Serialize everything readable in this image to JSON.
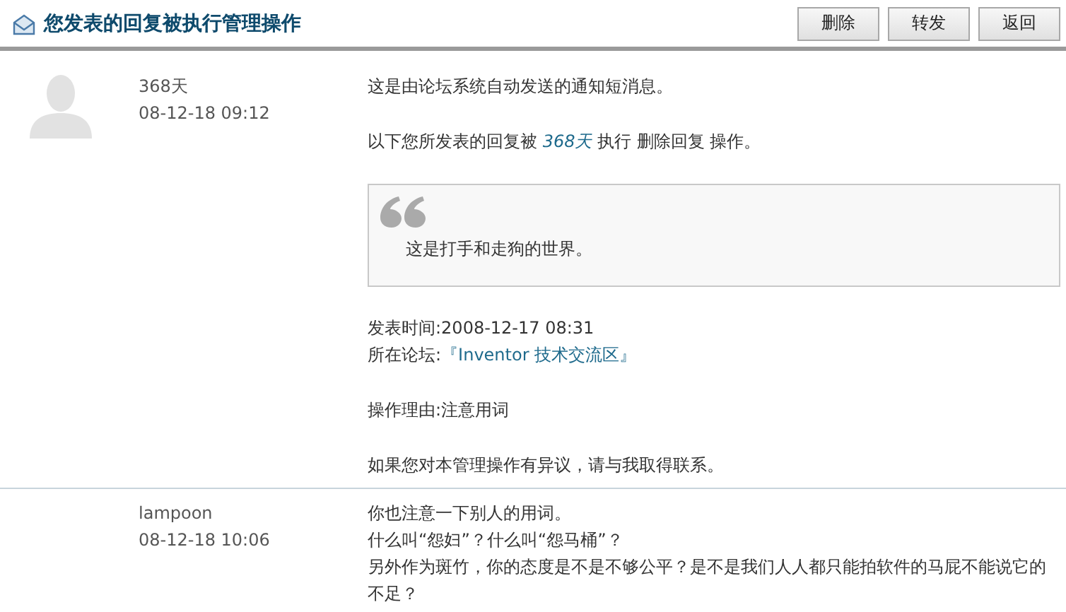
{
  "header": {
    "title": "您发表的回复被执行管理操作",
    "buttons": [
      "删除",
      "转发",
      "返回"
    ]
  },
  "messages": [
    {
      "author": "368天",
      "time": "08-12-18 09:12",
      "avatar": true,
      "blocks": [
        {
          "kind": "text",
          "text": "这是由论坛系统自动发送的通知短消息。"
        },
        {
          "kind": "action",
          "prefix": "以下您所发表的回复被",
          "user": "368天",
          "suffix": "执行  删除回复  操作。"
        },
        {
          "kind": "quote",
          "text": "这是打手和走狗的世界。"
        },
        {
          "kind": "meta",
          "fields": [
            {
              "label": "发表时间:",
              "value": "2008-12-17 08:31",
              "link": false
            },
            {
              "label": "所在论坛:",
              "value": "『Inventor 技术交流区』",
              "link": true
            }
          ]
        },
        {
          "kind": "meta",
          "fields": [
            {
              "label": "操作理由:",
              "value": "注意用词",
              "link": false
            }
          ]
        },
        {
          "kind": "text",
          "text": "如果您对本管理操作有异议，请与我取得联系。"
        }
      ]
    },
    {
      "author": "lampoon",
      "time": "08-12-18 10:06",
      "avatar": false,
      "blocks": [
        {
          "kind": "lines",
          "lines": [
            "你也注意一下别人的用词。",
            "什么叫“怨妇”？什么叫“怨马桶”？",
            "另外作为斑竹，你的态度是不是不够公平？是不是我们人人都只能拍软件的马屁不能说它的不足？"
          ]
        }
      ]
    }
  ]
}
